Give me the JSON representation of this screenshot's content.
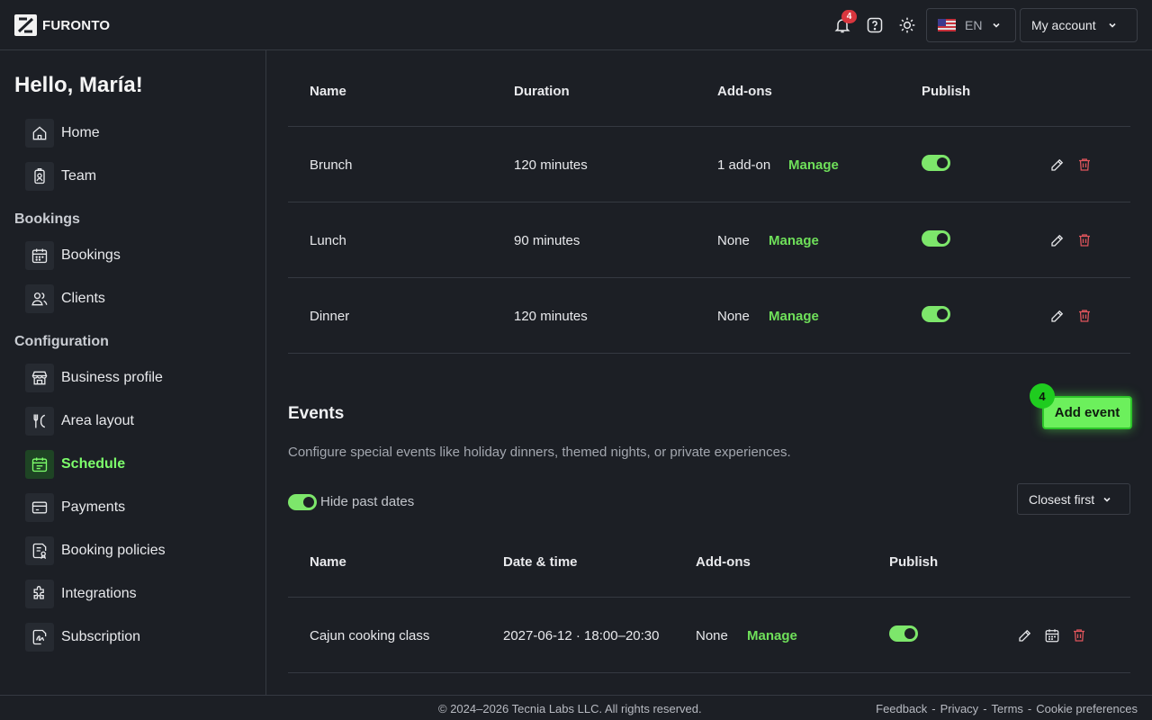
{
  "header": {
    "brand": "FURONTO",
    "notification_count": "4",
    "language_code": "EN",
    "account_label": "My account",
    "icons": [
      "bell-icon",
      "help-icon",
      "sun-icon",
      "us-flag-icon",
      "chevron-down-icon"
    ]
  },
  "sidebar": {
    "greeting": "Hello, María!",
    "top_items": [
      {
        "label": "Home",
        "icon": "home-icon"
      },
      {
        "label": "Team",
        "icon": "badge-icon"
      }
    ],
    "bookings_section": "Bookings",
    "bookings_items": [
      {
        "label": "Bookings",
        "icon": "calendar-icon"
      },
      {
        "label": "Clients",
        "icon": "users-icon"
      }
    ],
    "config_section": "Configuration",
    "config_items": [
      {
        "label": "Business profile",
        "icon": "store-icon"
      },
      {
        "label": "Area layout",
        "icon": "utensils-icon"
      },
      {
        "label": "Schedule",
        "icon": "calendar-list-icon",
        "active": true
      },
      {
        "label": "Payments",
        "icon": "card-icon"
      },
      {
        "label": "Booking policies",
        "icon": "policy-icon"
      },
      {
        "label": "Integrations",
        "icon": "puzzle-icon"
      },
      {
        "label": "Subscription",
        "icon": "signature-icon"
      }
    ]
  },
  "services_table": {
    "headers": [
      "Name",
      "Duration",
      "Add-ons",
      "Publish"
    ],
    "manage_label": "Manage",
    "rows": [
      {
        "name": "Brunch",
        "duration": "120 minutes",
        "addons": "1 add-on",
        "published": true
      },
      {
        "name": "Lunch",
        "duration": "90 minutes",
        "addons": "None",
        "published": true
      },
      {
        "name": "Dinner",
        "duration": "120 minutes",
        "addons": "None",
        "published": true
      }
    ]
  },
  "events": {
    "title": "Events",
    "description": "Configure special events like holiday dinners, themed nights, or private experiences.",
    "add_button": "Add event",
    "step_badge": "4",
    "hide_past_label": "Hide past dates",
    "hide_past_enabled": true,
    "sort_label": "Closest first",
    "headers": [
      "Name",
      "Date & time",
      "Add-ons",
      "Publish"
    ],
    "manage_label": "Manage",
    "rows": [
      {
        "name": "Cajun cooking class",
        "datetime": "2027-06-12 · 18:00–20:30",
        "addons": "None",
        "published": true
      }
    ]
  },
  "footer": {
    "copyright": "© 2024–2026 Tecnia Labs LLC. All rights reserved.",
    "links": [
      "Feedback",
      "Privacy",
      "Terms",
      "Cookie preferences"
    ]
  },
  "colors": {
    "background": "#1c1f25",
    "accent": "#7dff6b",
    "danger": "#e0555c"
  }
}
